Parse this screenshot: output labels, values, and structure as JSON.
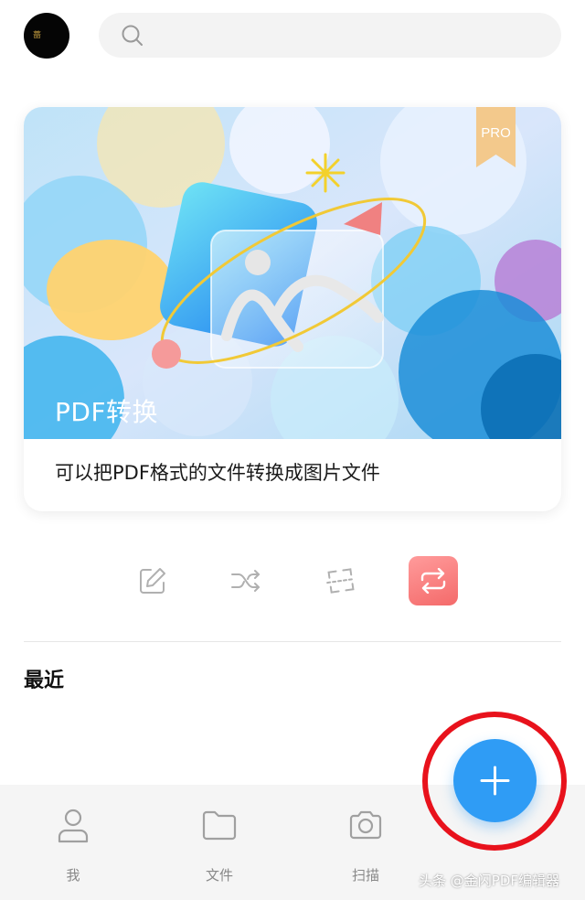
{
  "header": {
    "avatar_glyph": "蔷",
    "search_placeholder": ""
  },
  "banner": {
    "badge": "PRO",
    "title": "PDF转换",
    "description": "可以把PDF格式的文件转换成图片文件"
  },
  "tools": [
    {
      "icon": "edit-icon"
    },
    {
      "icon": "shuffle-icon"
    },
    {
      "icon": "scan-crop-icon"
    },
    {
      "icon": "convert-icon",
      "active": true
    }
  ],
  "recent": {
    "title": "最近"
  },
  "bottom_nav": {
    "items": [
      {
        "label": "我",
        "icon": "person-icon"
      },
      {
        "label": "文件",
        "icon": "folder-icon"
      },
      {
        "label": "扫描",
        "icon": "camera-icon"
      }
    ]
  },
  "fab": {
    "icon": "plus-icon"
  },
  "watermark": "头条 @金闪PDF编辑器",
  "colors": {
    "accent": "#2f9cf5",
    "highlight_ring": "#e8121c",
    "active_tool": "#f46a6a",
    "pro_badge": "#f3c98c"
  }
}
